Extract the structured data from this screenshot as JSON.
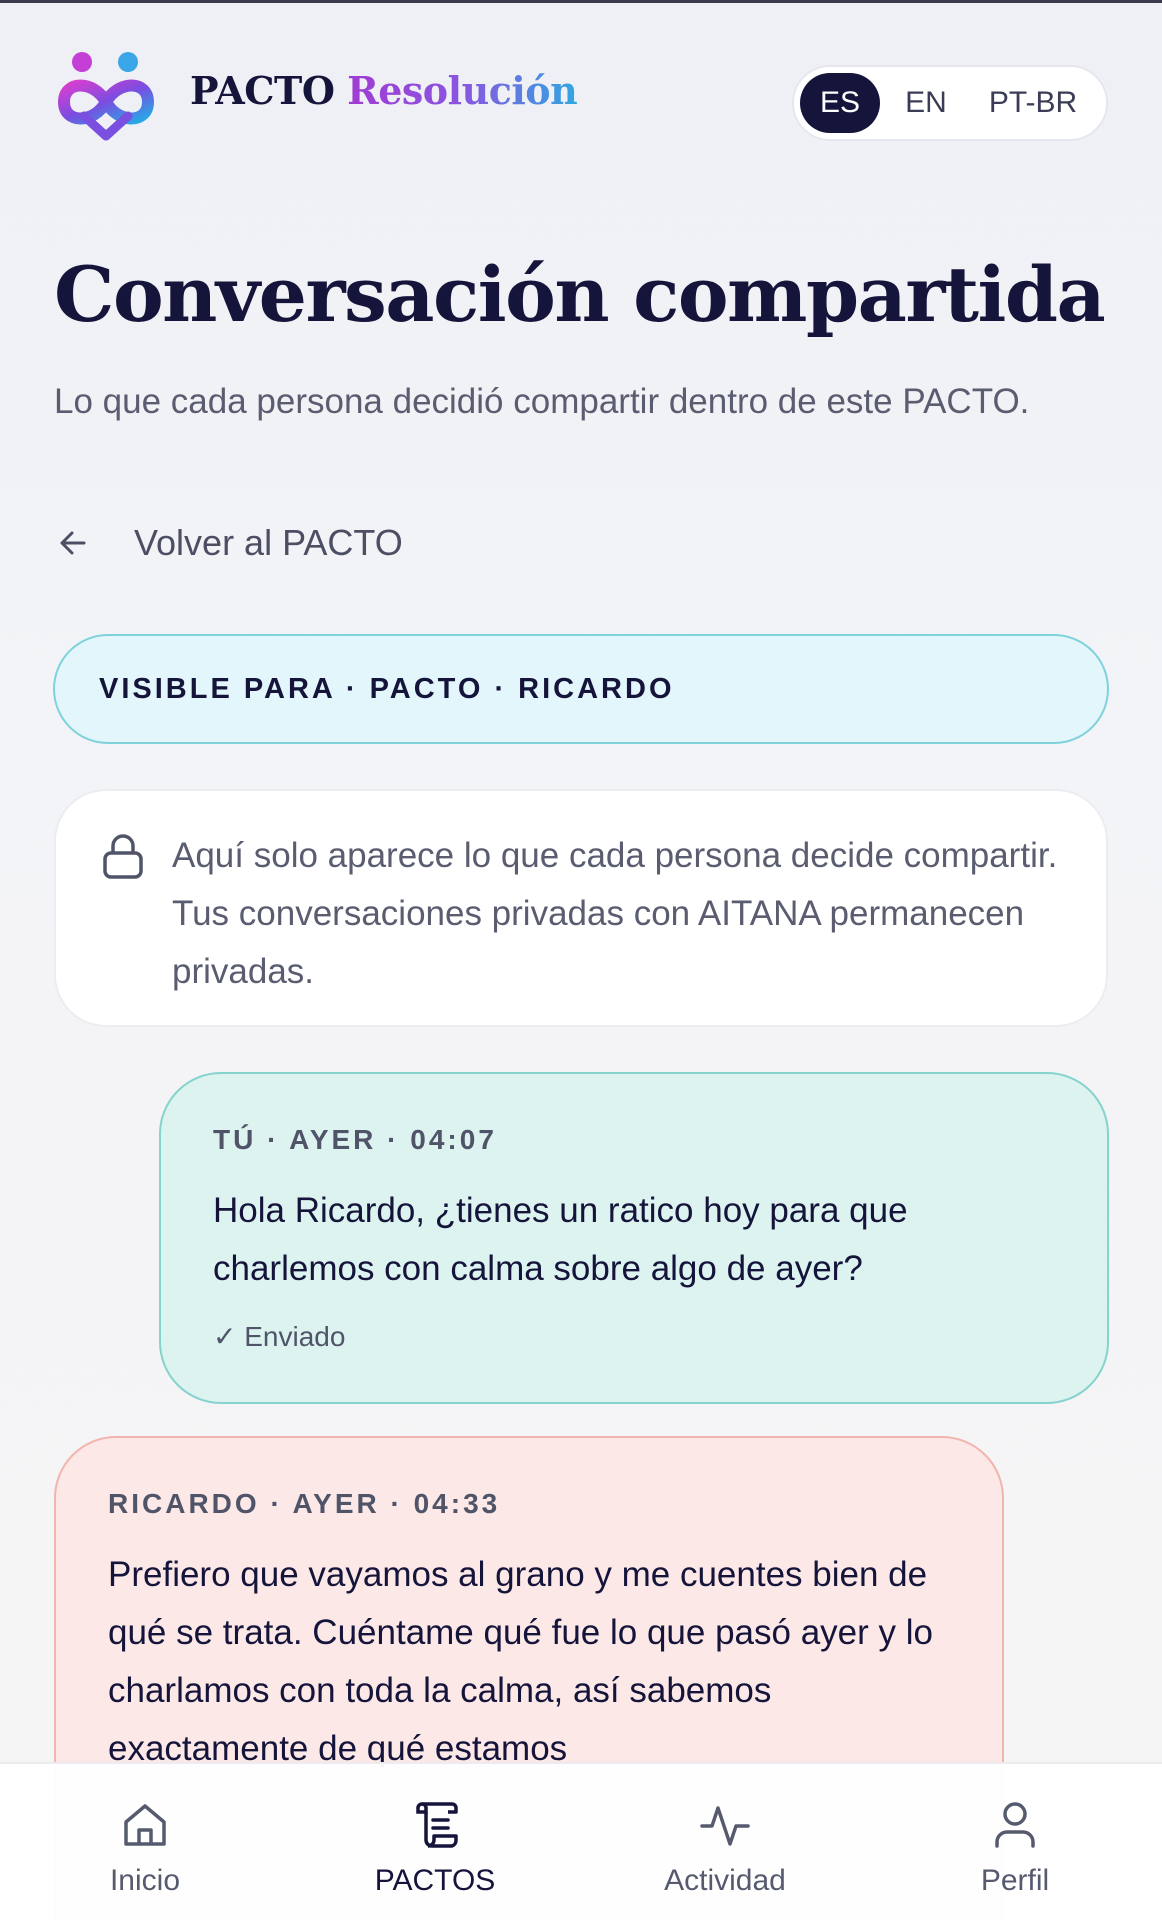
{
  "header": {
    "brand_primary": "PACTO",
    "brand_secondary": "Resolución",
    "languages": [
      {
        "label": "ES",
        "active": true
      },
      {
        "label": "EN",
        "active": false
      },
      {
        "label": "PT-BR",
        "active": false
      }
    ]
  },
  "page": {
    "title": "Conversación compartida",
    "subtitle": "Lo que cada persona decidió compartir dentro de este PACTO.",
    "back_label": "Volver al PACTO"
  },
  "visibility": {
    "label": "VISIBLE PARA · PACTO · RICARDO"
  },
  "notice": {
    "icon": "lock-icon",
    "text": "Aquí solo aparece lo que cada persona decide compartir. Tus conversaciones privadas con AITANA permanecen privadas."
  },
  "messages": [
    {
      "meta": "TÚ · AYER · 04:07",
      "text": "Hola Ricardo, ¿tienes un ratico hoy para que charlemos con calma sobre algo de ayer?",
      "status": "✓ Enviado",
      "from_me": true
    },
    {
      "meta": "RICARDO · AYER · 04:33",
      "text": "Prefiero que vayamos al grano y me cuentes bien de qué se trata. Cuéntame qué fue lo que pasó ayer y lo charlamos con toda la calma, así sabemos exactamente de qué estamos",
      "from_me": false
    }
  ],
  "nav": {
    "items": [
      {
        "label": "Inicio",
        "icon": "home-icon",
        "active": false
      },
      {
        "label": "PACTOS",
        "icon": "scroll-icon",
        "active": true
      },
      {
        "label": "Actividad",
        "icon": "activity-icon",
        "active": false
      },
      {
        "label": "Perfil",
        "icon": "user-icon",
        "active": false
      }
    ]
  },
  "colors": {
    "navy": "#15143b",
    "visible_bg": "#e2f6fb",
    "my_bubble": "#ddf3f0",
    "their_bubble": "#fce8e6"
  }
}
